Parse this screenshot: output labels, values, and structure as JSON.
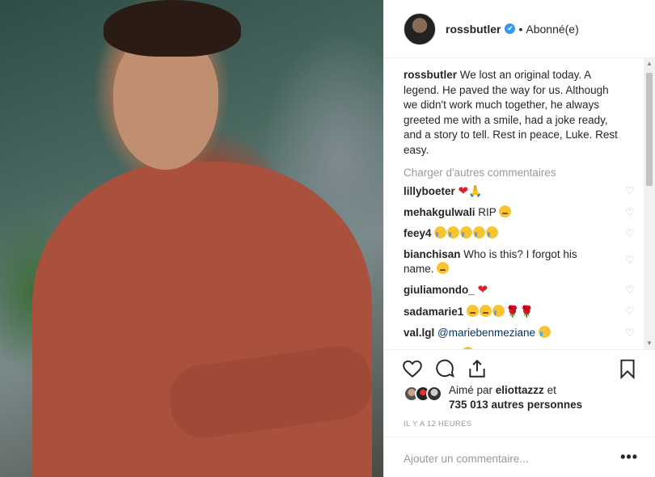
{
  "post": {
    "username": "rossbutler",
    "verified_badge": "✔",
    "follow_dot": "•",
    "follow_status": "Abonné(e)"
  },
  "caption": {
    "username": "rossbutler",
    "text": "We lost an original today. A legend. He paved the way for us. Although we didn't work much together, he always greeted me with a smile, had a joke ready, and a story to tell. Rest in peace, Luke. Rest easy."
  },
  "load_more_label": "Charger d'autres commentaires",
  "comments": [
    {
      "username": "lillyboeter",
      "text": ""
    },
    {
      "username": "mehakgulwali",
      "text": "RIP"
    },
    {
      "username": "feey4",
      "text": ""
    },
    {
      "username": "bianchisan",
      "text": "Who is this? I forgot his name."
    },
    {
      "username": "giuliamondo_",
      "text": ""
    },
    {
      "username": "sadamarie1",
      "text": ""
    },
    {
      "username": "val.lgl",
      "mention": "@mariebenmeziane"
    },
    {
      "username": "victoriaphj",
      "text": ""
    }
  ],
  "likes": {
    "prefix": "Aimé par",
    "user": "eliottazzz",
    "connector": "et",
    "count_text": "735 013 autres personnes"
  },
  "timestamp": "IL Y A 12 HEURES",
  "add_comment_placeholder": "Ajouter un commentaire...",
  "more_options": "•••",
  "icons": [
    "heart-icon",
    "comment-icon",
    "share-icon",
    "bookmark-icon",
    "like-heart-icon",
    "more-options-icon"
  ],
  "colors": {
    "verified": "#3897f0",
    "muted": "#999999",
    "text": "#262626",
    "mention": "#003569"
  }
}
